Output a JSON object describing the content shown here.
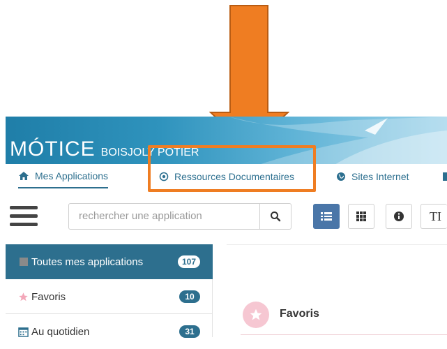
{
  "brand": {
    "title": "MÓTICE",
    "subtitle": "BOISJOLY POTIER"
  },
  "nav": {
    "items": [
      {
        "label": "Mes Applications",
        "icon": "home-icon",
        "active": true
      },
      {
        "label": "Ressources Documentaires",
        "icon": "circle-dot-icon",
        "active": false
      },
      {
        "label": "Sites Internet",
        "icon": "globe-icon",
        "active": false
      }
    ]
  },
  "toolbar": {
    "search_placeholder": "rechercher une application",
    "cut_text": "TI"
  },
  "sidebar": {
    "items": [
      {
        "label": "Toutes mes applications",
        "count": "107",
        "icon": "square-icon",
        "active": true
      },
      {
        "label": "Favoris",
        "count": "10",
        "icon": "star-icon",
        "active": false
      },
      {
        "label": "Au quotidien",
        "count": "31",
        "icon": "calendar-icon",
        "active": false
      }
    ]
  },
  "main": {
    "section_title": "Favoris"
  },
  "colors": {
    "accent": "#2d6f8e",
    "highlight": "#ef7d22",
    "badge": "#2d6f8e",
    "favorite_pink": "#f6c7d2"
  }
}
